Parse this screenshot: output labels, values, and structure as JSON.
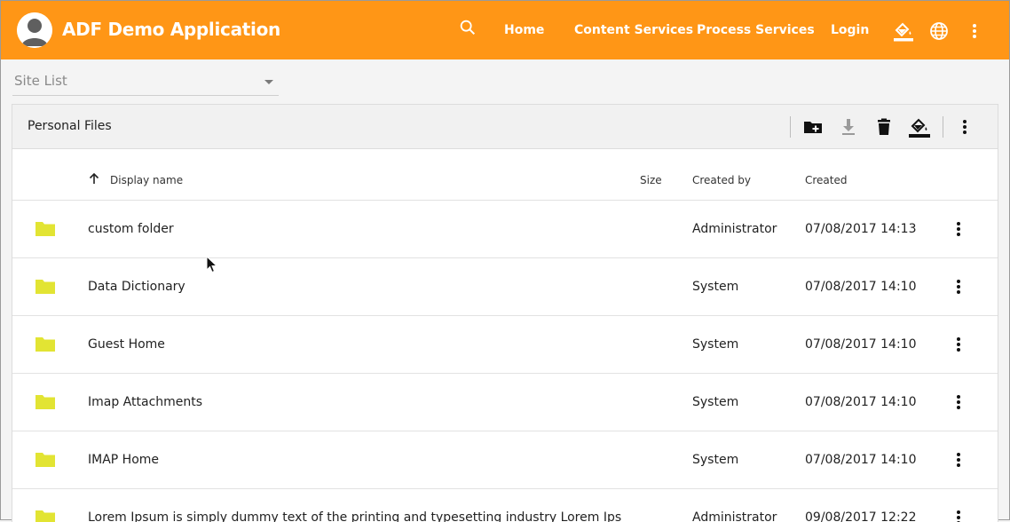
{
  "app": {
    "title": "ADF Demo Application",
    "nav": [
      "Home",
      "Content Services",
      "Process Services",
      "Login"
    ],
    "brand_color": "#ff9616"
  },
  "site_list": {
    "placeholder": "Site List"
  },
  "toolbar": {
    "breadcrumb": "Personal Files",
    "actions": [
      "create-folder-icon",
      "download-icon",
      "delete-icon",
      "theme-icon",
      "more-vert-icon"
    ]
  },
  "table": {
    "columns": {
      "name": "Display name",
      "size": "Size",
      "created_by": "Created by",
      "created": "Created"
    },
    "rows": [
      {
        "name": "custom folder",
        "created_by": "Administrator",
        "created": "07/08/2017 14:13"
      },
      {
        "name": "Data Dictionary",
        "created_by": "System",
        "created": "07/08/2017 14:10"
      },
      {
        "name": "Guest Home",
        "created_by": "System",
        "created": "07/08/2017 14:10"
      },
      {
        "name": "Imap Attachments",
        "created_by": "System",
        "created": "07/08/2017 14:10"
      },
      {
        "name": "IMAP Home",
        "created_by": "System",
        "created": "07/08/2017 14:10"
      },
      {
        "name": "Lorem Ipsum is simply dummy text of the printing and typesetting industry Lorem Ips",
        "created_by": "Administrator",
        "created": "09/08/2017 12:22"
      }
    ],
    "folder_color": "#e2e433"
  }
}
